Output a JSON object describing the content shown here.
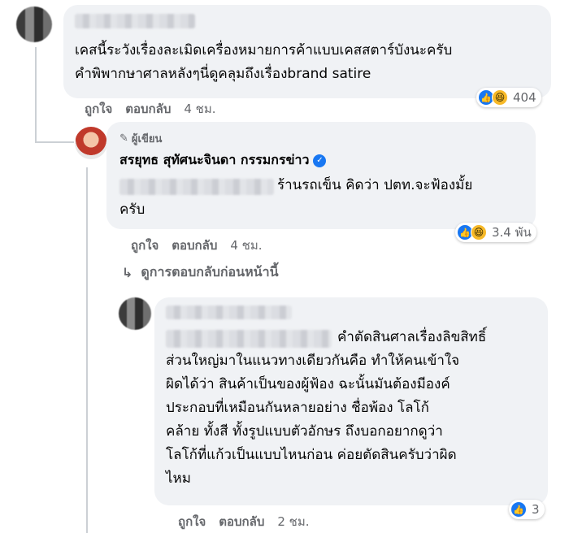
{
  "comment1": {
    "text": "เคสนี้ระวังเรื่องละเมิดเครื่องหมายการค้าแบบเคสสตาร์บังนะครับ\nคำพิพากษาศาลหลังๆนี่ดูคลุมถึงเรื่องbrand satire",
    "reaction_count": "404",
    "like_label": "ถูกใจ",
    "reply_label": "ตอบกลับ",
    "time": "4 ชม."
  },
  "comment2": {
    "author_badge": "ผู้เขียน",
    "author_name": "สรยุทธ สุทัศนะจินดา กรรมกรข่าว",
    "text_line1": "ร้านรถเข็น คิดว่า ปตท.จะฟ้องมั้ย",
    "text_line2": "ครับ",
    "reaction_count": "3.4 พัน",
    "like_label": "ถูกใจ",
    "reply_label": "ตอบกลับ",
    "time": "4 ชม."
  },
  "view_previous": "ดูการตอบกลับก่อนหน้านี้",
  "comment3": {
    "text_line1": "คำตัดสินศาลเรื่องลิขสิทธิ์",
    "text_rest": "ส่วนใหญ่มาในแนวทางเดียวกันคือ ทำให้คนเข้าใจ\nผิดได้ว่า สินค้าเป็นของผู้ฟ้อง ฉะนั้นมันต้องมีองค์\nประกอบที่เหมือนกันหลายอย่าง ชื่อพ้อง โลโก้\nคล้าย ทั้งสี ทั้งรูปแบบตัวอักษร ถึงบอกอยากดูว่า\nโลโก้ที่แก้วเป็นแบบไหนก่อน ค่อยตัดสินครับว่าผิด\nไหม",
    "reaction_count": "3",
    "like_label": "ถูกใจ",
    "reply_label": "ตอบกลับ",
    "time": "2 ชม."
  },
  "colors": {
    "bubble": "#f0f2f5",
    "meta_text": "#65676b",
    "like_blue": "#1877f2",
    "haha_yellow": "#f7b928"
  }
}
